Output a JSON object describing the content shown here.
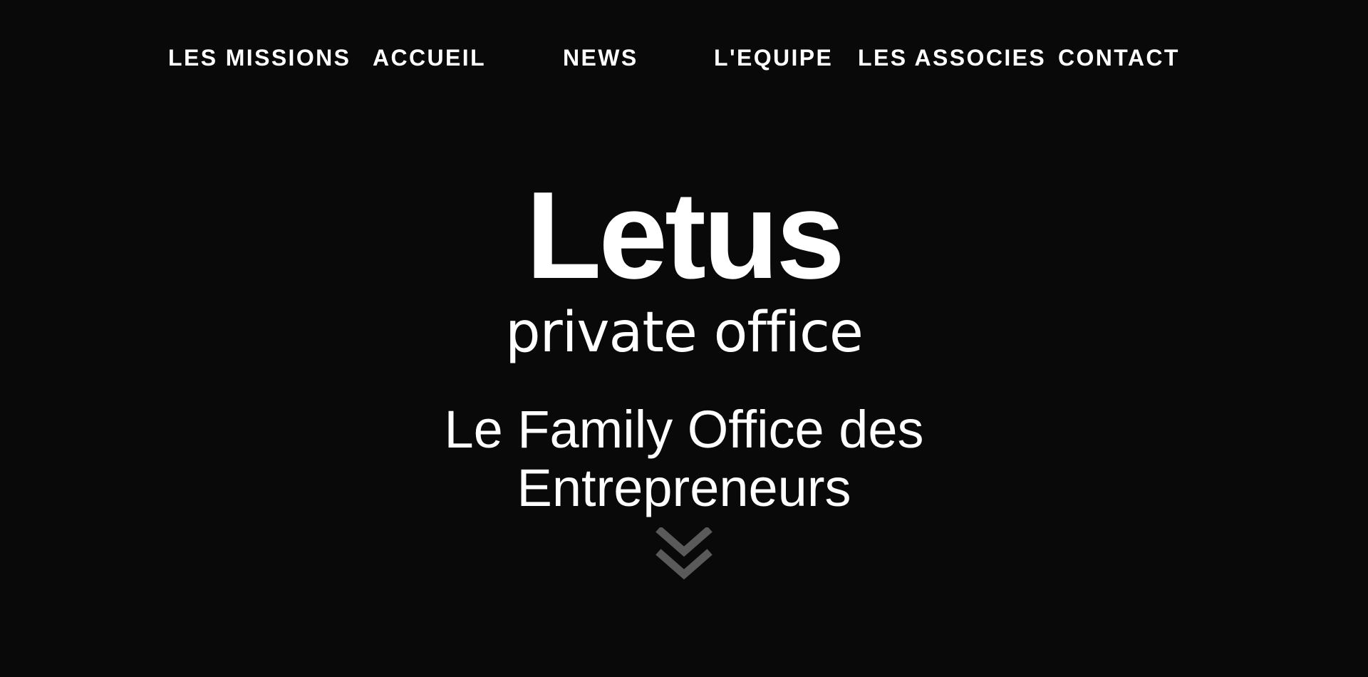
{
  "nav": {
    "items": [
      {
        "label": "LES MISSIONS"
      },
      {
        "label": "ACCUEIL"
      },
      {
        "label": "NEWS"
      },
      {
        "label": "L'EQUIPE"
      },
      {
        "label": "LES ASSOCIES"
      },
      {
        "label": "CONTACT"
      }
    ]
  },
  "hero": {
    "logo_wordmark": "Letus",
    "logo_tagline": "private office",
    "headline_line1": "Le Family Office des",
    "headline_line2": "Entrepreneurs",
    "scroll_icon": "double-chevron-down-icon"
  },
  "colors": {
    "background": "#0a090a",
    "text": "#ffffff",
    "chevron": "#5a5a5a"
  }
}
